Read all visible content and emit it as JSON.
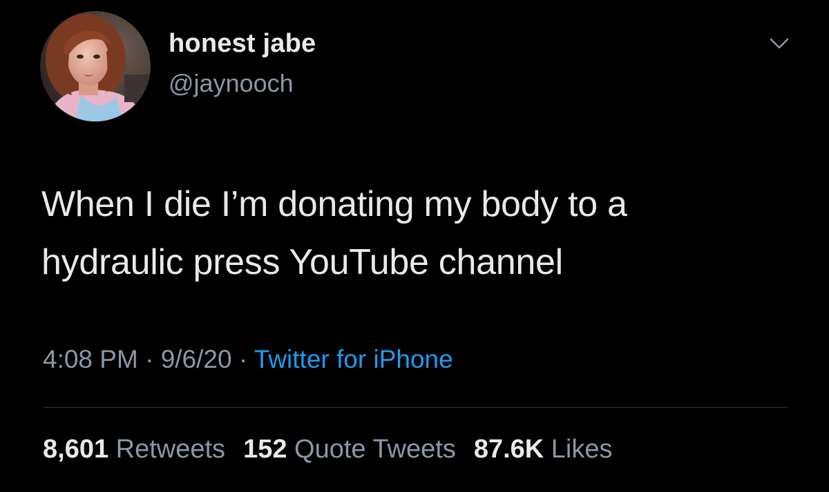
{
  "author": {
    "display_name": "honest jabe",
    "handle": "@jaynooch",
    "avatar_icon": "profile-photo"
  },
  "tweet": {
    "lines": [
      "When I die I’m donating my body to a",
      "hydraulic press YouTube channel"
    ]
  },
  "meta": {
    "time": "4:08 PM",
    "separator": " · ",
    "date": "9/6/20",
    "source": "Twitter for iPhone"
  },
  "stats": {
    "retweets_count": "8,601",
    "retweets_label": "Retweets",
    "quotes_count": "152",
    "quotes_label": "Quote Tweets",
    "likes_count": "87.6K",
    "likes_label": "Likes"
  },
  "colors": {
    "background": "#000000",
    "primary_text": "#e7e9ea",
    "secondary_text": "#8b98a5",
    "link": "#1d9bf0",
    "divider": "#2f3336"
  },
  "icons": {
    "menu": "chevron-down-icon"
  }
}
